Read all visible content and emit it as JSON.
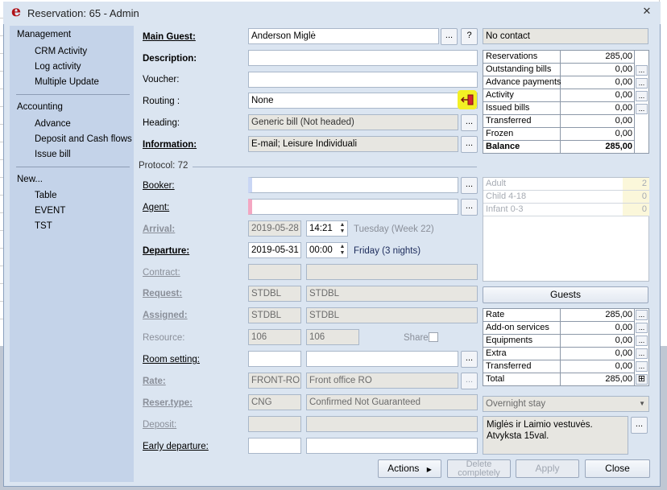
{
  "window": {
    "title": "Reservation: 65 - Admin",
    "logo": "e"
  },
  "sidebar": {
    "sections": [
      {
        "heading": "Management",
        "items": [
          "CRM Activity",
          "Log activity",
          "Multiple Update"
        ]
      },
      {
        "heading": "Accounting",
        "items": [
          "Advance",
          "Deposit and Cash flows",
          "Issue bill"
        ]
      },
      {
        "heading": "New...",
        "items": [
          "Table",
          "EVENT",
          "TST"
        ]
      }
    ]
  },
  "form": {
    "main_guest": {
      "label": "Main Guest:",
      "value": "Anderson Miglė",
      "btn": "...",
      "help": "?"
    },
    "contact": "No contact",
    "description": {
      "label": "Description:",
      "value": ""
    },
    "voucher": {
      "label": "Voucher:",
      "value": ""
    },
    "routing": {
      "label": "Routing :",
      "value": "None"
    },
    "heading": {
      "label": "Heading:",
      "value": "Generic bill (Not headed)"
    },
    "information": {
      "label": "Information:",
      "value": "E-mail; Leisure Individuali"
    },
    "protocol": "Protocol: 72",
    "booker": {
      "label": "Booker:",
      "value": ""
    },
    "agent": {
      "label": "Agent:",
      "value": ""
    },
    "arrival": {
      "label": "Arrival:",
      "date": "2019-05-28",
      "time": "14:21",
      "info": "Tuesday (Week 22)"
    },
    "departure": {
      "label": "Departure:",
      "date": "2019-05-31",
      "time": "00:00",
      "info": "Friday (3 nights)"
    },
    "contract": {
      "label": "Contract:"
    },
    "request": {
      "label": "Request:",
      "code": "STDBL",
      "name": "STDBL"
    },
    "assigned": {
      "label": "Assigned:",
      "code": "STDBL",
      "name": "STDBL"
    },
    "resource": {
      "label": "Resource:",
      "code": "106",
      "name": "106",
      "share": "Share"
    },
    "room_setting": {
      "label": "Room setting:"
    },
    "rate": {
      "label": "Rate:",
      "code": "FRONT-RO",
      "name": "Front office RO"
    },
    "reser_type": {
      "label": "Reser.type:",
      "code": "CNG",
      "name": "Confirmed Not Guaranteed"
    },
    "deposit": {
      "label": "Deposit:"
    },
    "early_departure": {
      "label": "Early departure:"
    }
  },
  "summary": [
    {
      "k": "Reservations",
      "v": "285,00",
      "btn": false,
      "bold": false
    },
    {
      "k": "Outstanding bills",
      "v": "0,00",
      "btn": true,
      "bold": false
    },
    {
      "k": "Advance payments",
      "v": "0,00",
      "btn": true,
      "bold": false
    },
    {
      "k": "Activity",
      "v": "0,00",
      "btn": true,
      "bold": false
    },
    {
      "k": "Issued bills",
      "v": "0,00",
      "btn": true,
      "bold": false
    },
    {
      "k": "Transferred",
      "v": "0,00",
      "btn": false,
      "bold": false
    },
    {
      "k": "Frozen",
      "v": "0,00",
      "btn": false,
      "bold": false
    },
    {
      "k": "Balance",
      "v": "285,00",
      "btn": false,
      "bold": true
    }
  ],
  "pax": [
    {
      "k": "Adult",
      "v": "2"
    },
    {
      "k": "Child 4-18",
      "v": "0"
    },
    {
      "k": "Infant 0-3",
      "v": "0"
    }
  ],
  "guests_btn": "Guests",
  "rates": [
    {
      "k": "Rate",
      "v": "285,00"
    },
    {
      "k": "Add-on services",
      "v": "0,00"
    },
    {
      "k": "Equipments",
      "v": "0,00"
    },
    {
      "k": "Extra",
      "v": "0,00"
    },
    {
      "k": "Transferred",
      "v": "0,00"
    },
    {
      "k": "Total",
      "v": "285,00"
    }
  ],
  "stay_type": "Overnight stay",
  "note": "Miglės ir Laimio vestuvės. Atvyksta 15val.",
  "buttons": {
    "actions": "Actions",
    "delete": "Delete completely",
    "apply": "Apply",
    "close": "Close"
  }
}
